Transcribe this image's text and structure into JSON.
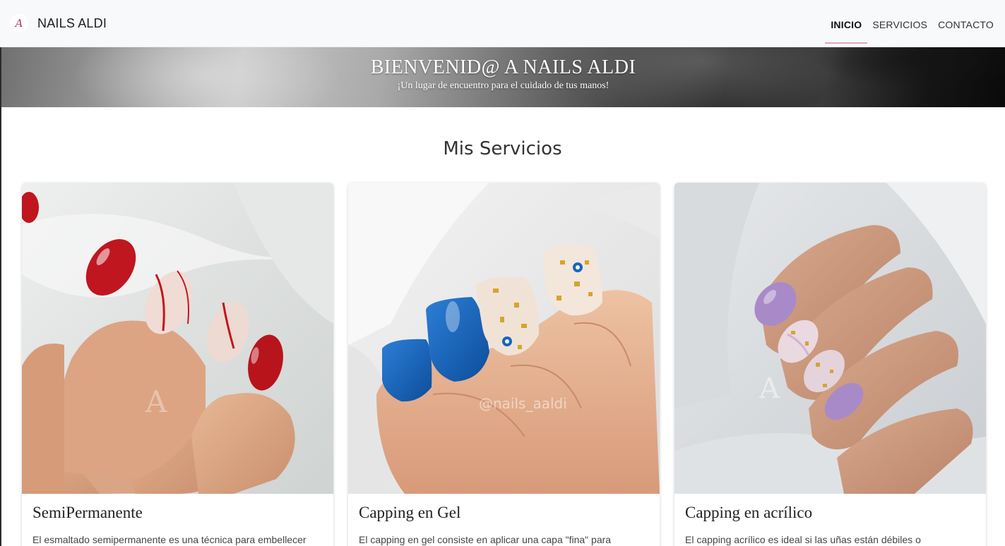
{
  "navbar": {
    "logo_glyph": "A",
    "brand": "NAILS ALDI",
    "links": [
      {
        "label": "INICIO",
        "active": true
      },
      {
        "label": "SERVICIOS",
        "active": false
      },
      {
        "label": "CONTACTO",
        "active": false
      }
    ],
    "active_underline_color": "#e3a3c0"
  },
  "hero": {
    "title": "BIENVENID@ A NAILS ALDI",
    "subtitle": "¡Un lugar de encuentro para el cuidado de tus manos!"
  },
  "services": {
    "heading": "Mis Servicios",
    "cards": [
      {
        "title": "SemiPermanente",
        "text": "El esmaltado semipermanente es una técnica para embellecer",
        "image": "red-and-white-nails-photo"
      },
      {
        "title": "Capping en Gel",
        "text": "El capping en gel consiste en aplicar una capa \"fina\" para",
        "image": "blue-and-gold-nails-photo",
        "watermark": "@nails_aaldi"
      },
      {
        "title": "Capping en acrílico",
        "text": "El capping acrílico es ideal si las uñas están débiles o",
        "image": "lilac-nails-photo"
      }
    ]
  }
}
